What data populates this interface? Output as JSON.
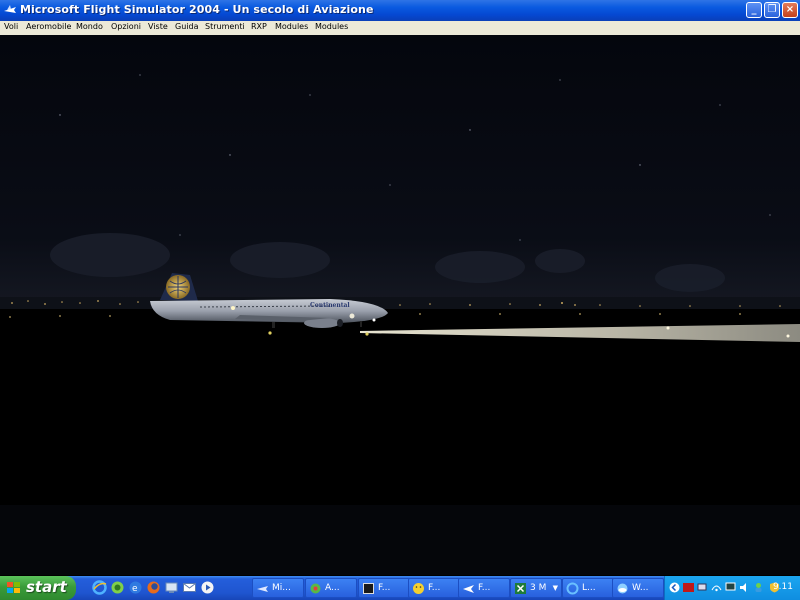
{
  "window": {
    "title": "Microsoft Flight Simulator 2004 - Un secolo di Aviazione",
    "controls": {
      "minimize": "_",
      "maximize": "❐",
      "close": "×"
    }
  },
  "menubar": {
    "items": [
      "Voli",
      "Aeromobile",
      "Mondo",
      "Opzioni",
      "Viste",
      "Guida",
      "Strumenti",
      "RXP",
      "Modules",
      "Modules"
    ]
  },
  "scene": {
    "aircraft_livery": "Continental",
    "sky_color": "#05070f",
    "ground_color": "#000000",
    "landing_light_color": "#e8e4d0"
  },
  "taskbar": {
    "start_label": "start",
    "quick_launch": [
      "ie-icon",
      "messenger-icon",
      "ie-alt-icon",
      "firefox-icon",
      "network-icon",
      "mail-icon",
      "media-icon"
    ],
    "tasks": [
      {
        "label": "Mi...",
        "icon": "flight-sim-icon"
      },
      {
        "label": "A...",
        "icon": "app-icon"
      },
      {
        "label": "F...",
        "icon": "window-icon"
      },
      {
        "label": "F...",
        "icon": "smiley-icon"
      },
      {
        "label": "F...",
        "icon": "plane-icon"
      },
      {
        "label": "3 M",
        "icon": "excel-icon"
      },
      {
        "label": "L...",
        "icon": "ie-icon"
      },
      {
        "label": "W...",
        "icon": "weather-icon"
      }
    ],
    "clock": "9.11"
  },
  "colors": {
    "titlebar": "#0a5ae0",
    "menubar": "#ece9d8",
    "taskbar": "#245edb",
    "start": "#3a9b3a",
    "tray": "#0f8ee0"
  }
}
